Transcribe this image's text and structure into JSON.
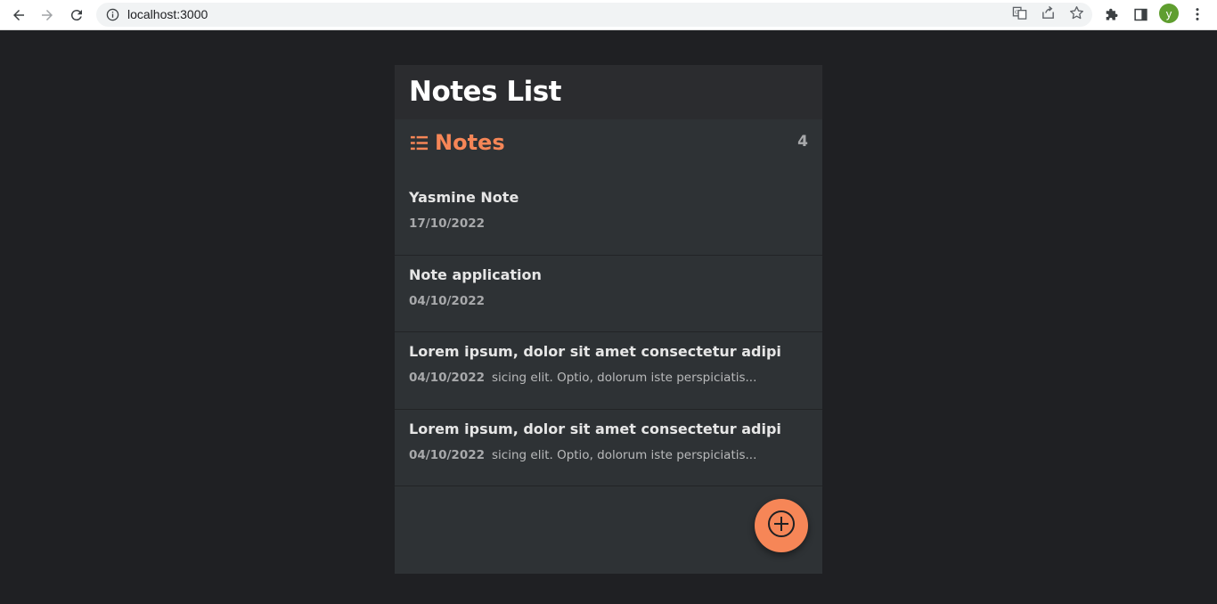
{
  "browser": {
    "url": "localhost:3000",
    "avatar_letter": "y",
    "icons": {
      "back": "arrow-left-icon",
      "forward": "arrow-right-icon",
      "reload": "reload-icon",
      "site_info": "info-icon",
      "translate": "translate-icon",
      "share": "share-icon",
      "bookmark": "star-icon",
      "extensions": "puzzle-icon",
      "side_panel": "side-panel-icon",
      "menu": "kebab-menu-icon"
    }
  },
  "app": {
    "title": "Notes List",
    "colors": {
      "accent": "#f68657",
      "background": "#1f2023",
      "card": "#2e3235",
      "header": "#2b2c2f"
    },
    "notes_header": {
      "icon": "list-icon",
      "label": "Notes",
      "count": "4"
    },
    "notes": [
      {
        "title": "Yasmine Note",
        "date": "17/10/2022",
        "preview": ""
      },
      {
        "title": "Note application",
        "date": "04/10/2022",
        "preview": ""
      },
      {
        "title": "Lorem ipsum, dolor sit amet consectetur adipi",
        "date": "04/10/2022",
        "preview": "sicing elit. Optio, dolorum iste perspiciatis..."
      },
      {
        "title": "Lorem ipsum, dolor sit amet consectetur adipi",
        "date": "04/10/2022",
        "preview": "sicing elit. Optio, dolorum iste perspiciatis..."
      }
    ],
    "fab_icon": "add-circle-icon"
  }
}
